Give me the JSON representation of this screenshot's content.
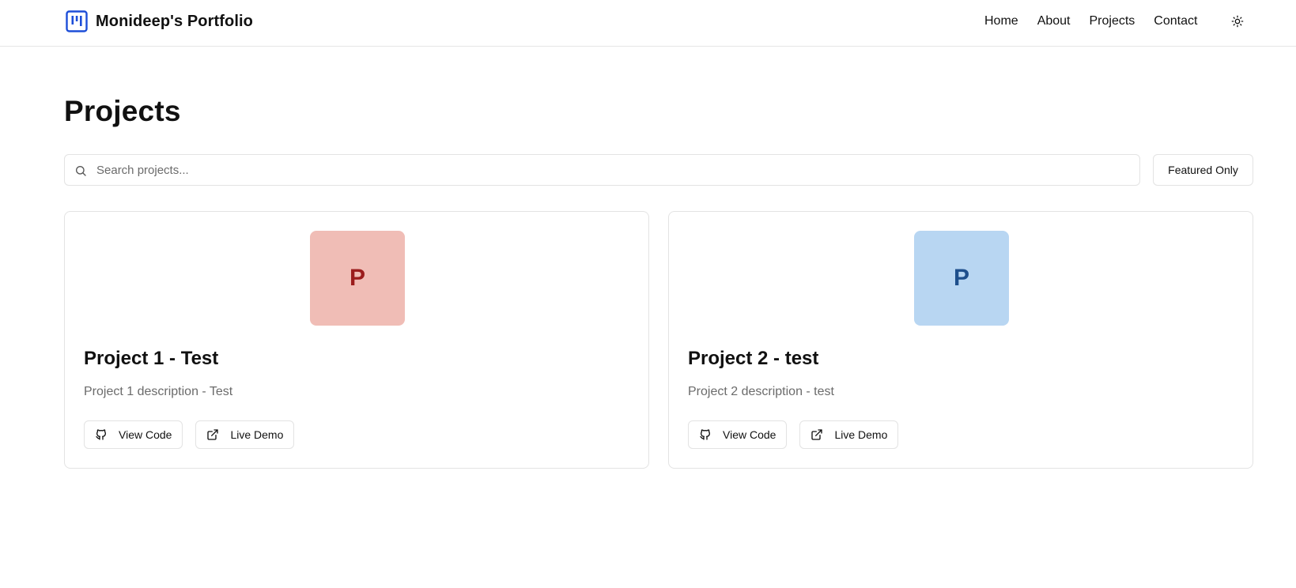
{
  "header": {
    "title": "Monideep's Portfolio",
    "logo_icon": "kanban-icon",
    "accent": "#1d4ed8",
    "nav": [
      {
        "label": "Home"
      },
      {
        "label": "About"
      },
      {
        "label": "Projects"
      },
      {
        "label": "Contact"
      }
    ],
    "theme_toggle_icon": "sun-icon"
  },
  "main": {
    "title": "Projects",
    "search": {
      "placeholder": "Search projects...",
      "value": "",
      "icon": "search-icon"
    },
    "filter_button_label": "Featured Only",
    "projects": [
      {
        "thumb_letter": "P",
        "thumb_bg": "#f0bdb6",
        "thumb_fg": "#9b1c1c",
        "title": "Project 1 - Test",
        "description": "Project 1 description - Test",
        "code_label": "View Code",
        "code_icon": "github-icon",
        "demo_label": "Live Demo",
        "demo_icon": "external-link-icon"
      },
      {
        "thumb_letter": "P",
        "thumb_bg": "#b8d6f2",
        "thumb_fg": "#1e4f8c",
        "title": "Project 2 - test",
        "description": "Project 2 description - test",
        "code_label": "View Code",
        "code_icon": "github-icon",
        "demo_label": "Live Demo",
        "demo_icon": "external-link-icon"
      }
    ]
  }
}
